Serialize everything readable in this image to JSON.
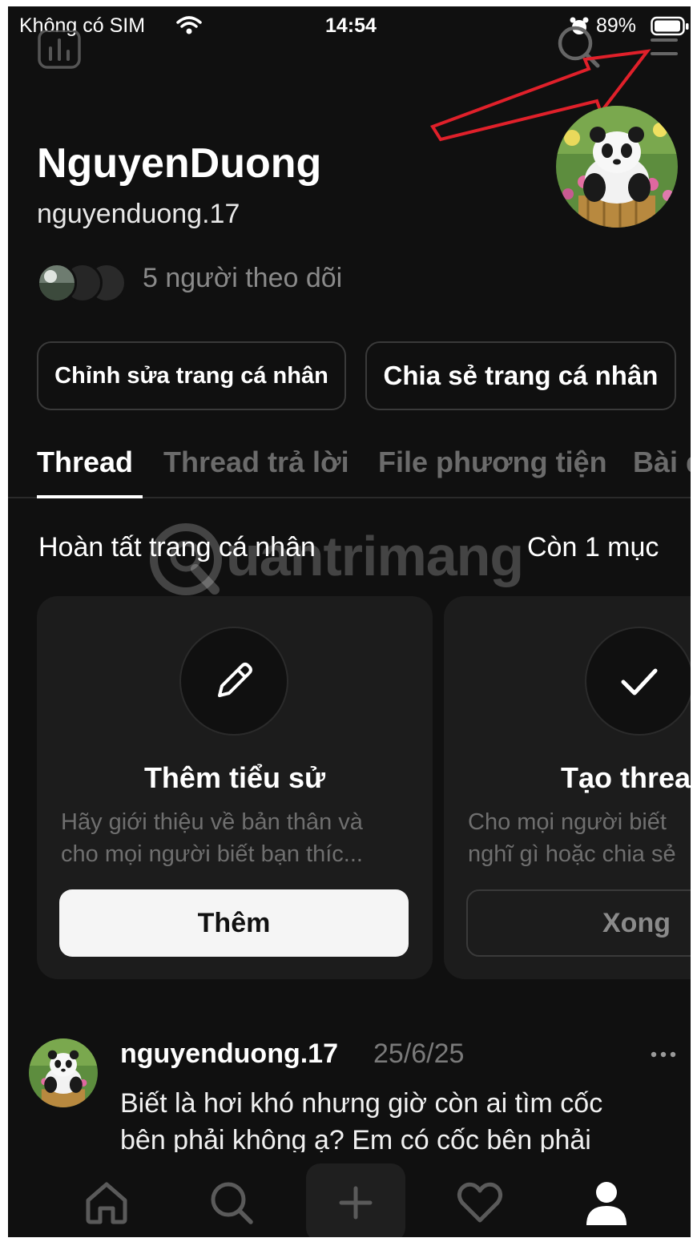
{
  "status_bar": {
    "carrier": "Không có SIM",
    "time": "14:54",
    "battery": "89%"
  },
  "profile": {
    "display_name": "NguyenDuong",
    "username": "nguyenduong.17",
    "followers_text": "5 người theo dõi",
    "edit_button": "Chỉnh sửa trang cá nhân",
    "share_button": "Chia sẻ trang cá nhân"
  },
  "tabs": [
    {
      "label": "Thread"
    },
    {
      "label": "Thread trả lời"
    },
    {
      "label": "File phương tiện"
    },
    {
      "label": "Bài đ"
    }
  ],
  "complete_profile": {
    "title": "Hoàn tất trang cá nhân",
    "remaining": "Còn 1 mục",
    "cards": [
      {
        "icon": "pencil-icon",
        "title": "Thêm tiểu sử",
        "desc_line1": "Hãy giới thiệu về bản thân và",
        "desc_line2": "cho mọi người biết bạn thíc...",
        "button": "Thêm"
      },
      {
        "icon": "check-icon",
        "title": "Tạo threa",
        "desc_line1": "Cho mọi người biết",
        "desc_line2": "nghĩ gì hoặc chia sẻ",
        "button": "Xong"
      }
    ]
  },
  "post": {
    "username": "nguyenduong.17",
    "date": "25/6/25",
    "line1": "Biết là hơi khó nhưng giờ còn ai tìm cốc",
    "line2": "bên phải không ạ? Em có cốc bên phải"
  },
  "watermark": "uantrimang",
  "colors": {
    "background": "#101010",
    "card": "#1c1c1c",
    "arrow": "#e0202a"
  }
}
